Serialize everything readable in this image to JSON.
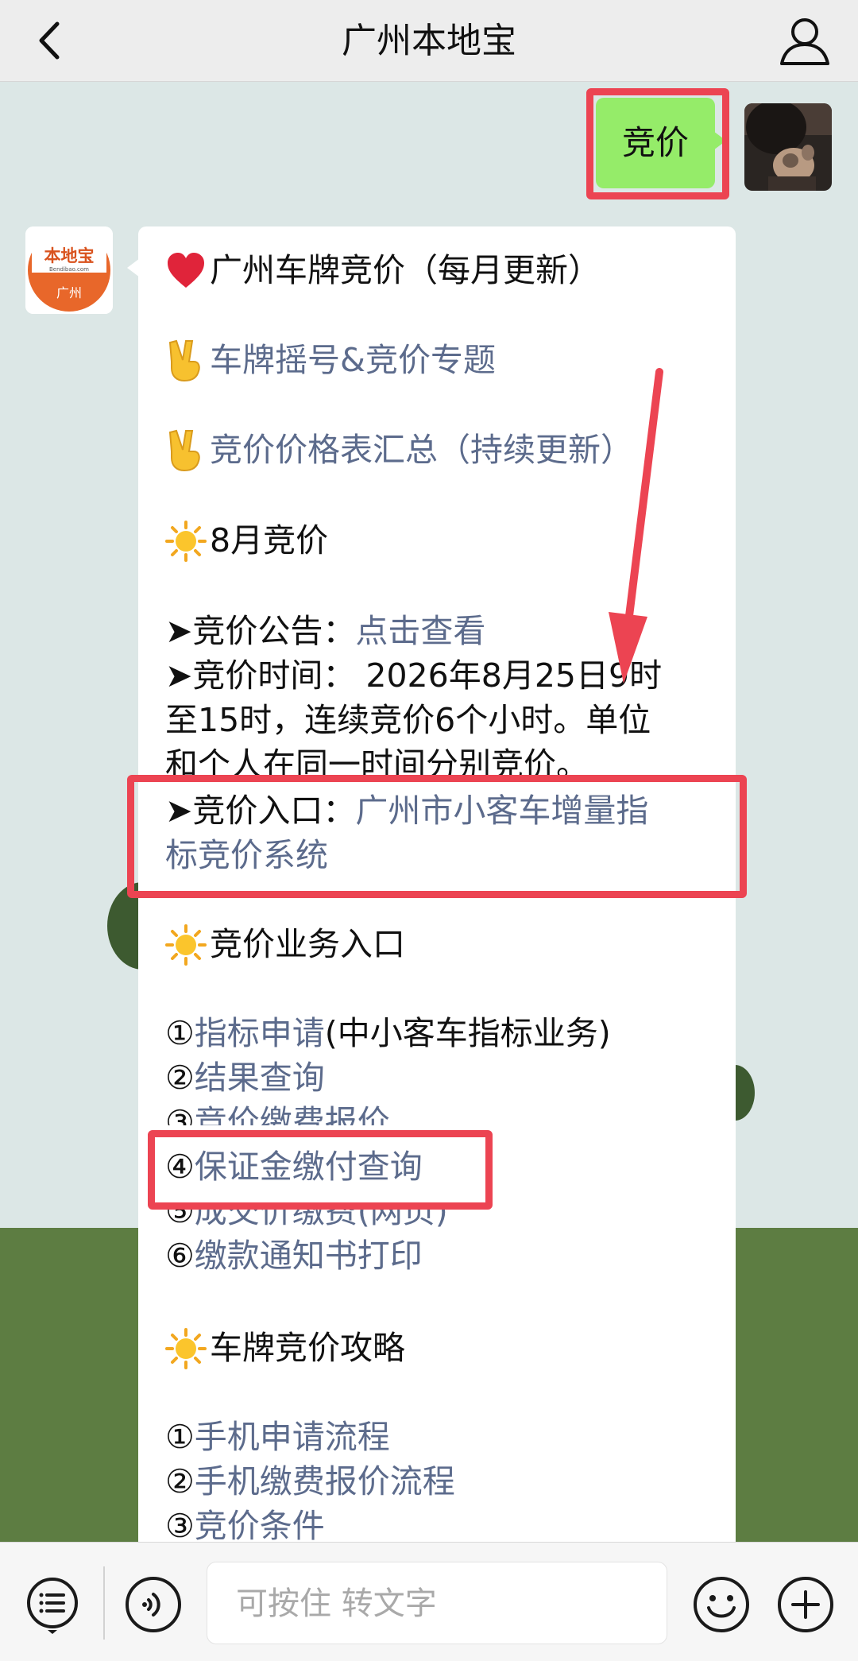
{
  "nav": {
    "title": "广州本地宝"
  },
  "sent_message": "竞价",
  "bot_avatar": {
    "logo": "本地宝",
    "domain": "Bendibao.com",
    "city": "广州"
  },
  "message": {
    "heading": "广州车牌竞价（每月更新）",
    "topic_link": "车牌摇号&竞价专题",
    "price_link": "竞价价格表汇总（持续更新）",
    "month_heading": "8月竞价",
    "notice_label": "➤竞价公告：",
    "notice_link": "点击查看",
    "time_line1": "➤竞价时间： 2026年8月25日9时",
    "time_line2": "至15时，连续竞价6个小时。单位",
    "time_line3": "和个人在同一时间分别竞价。",
    "entry_label": "➤竞价入口：",
    "entry_link1": "广州市小客车增量指",
    "entry_link2": "标竞价系统",
    "business_heading": "竞价业务入口",
    "business_items": [
      {
        "num": "①",
        "link": "指标申请",
        "extra": "(中小客车指标业务)"
      },
      {
        "num": "②",
        "link": "结果查询",
        "extra": ""
      },
      {
        "num": "③",
        "link": "竞价缴费报价",
        "extra": ""
      },
      {
        "num": "④",
        "link": "保证金缴付查询",
        "extra": ""
      },
      {
        "num": "⑤",
        "link": "成交价缴费(网页)",
        "extra": ""
      },
      {
        "num": "⑥",
        "link": "缴款通知书打印",
        "extra": ""
      }
    ],
    "guide_heading": "车牌竞价攻略",
    "guide_items": [
      {
        "num": "①",
        "link": "手机申请流程"
      },
      {
        "num": "②",
        "link": "手机缴费报价流程"
      },
      {
        "num": "③",
        "link": "竞价条件"
      }
    ]
  },
  "input": {
    "placeholder": "可按住 转文字"
  },
  "icons": {
    "back": "chevron-left-icon",
    "profile": "person-icon",
    "menu": "menu-list-icon",
    "voice": "voice-icon",
    "emoji": "smiley-icon",
    "add": "plus-icon"
  },
  "colors": {
    "highlight": "#ec4452",
    "link": "#5c6b8c",
    "sent_bubble": "#95ec69",
    "chat_bg": "#dce7e6"
  }
}
